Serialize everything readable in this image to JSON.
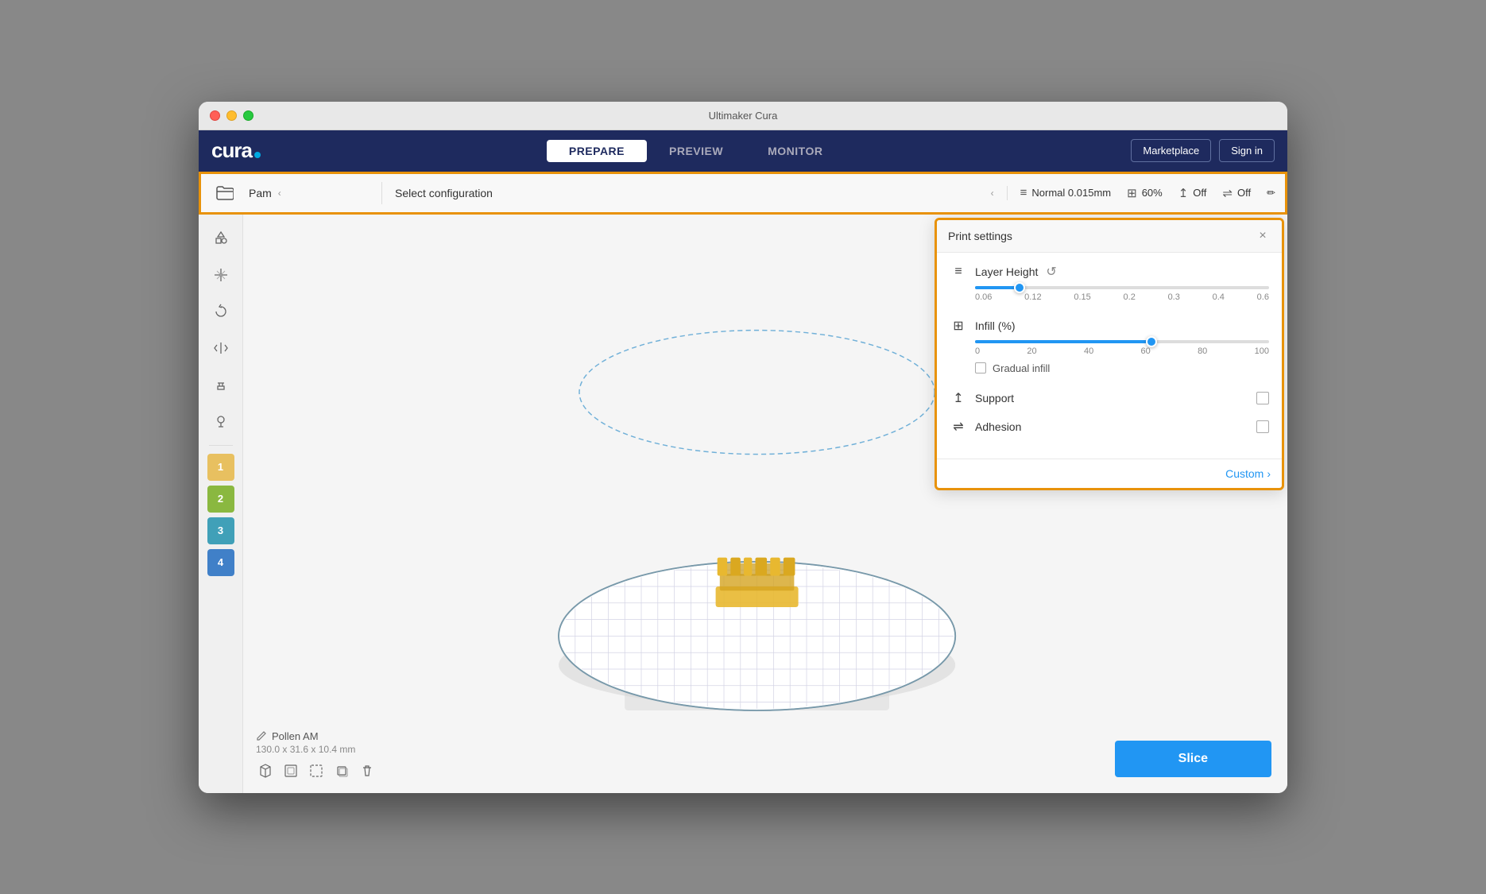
{
  "window": {
    "title": "Ultimaker Cura"
  },
  "nav": {
    "logo": "cura",
    "tabs": [
      {
        "label": "PREPARE",
        "active": true
      },
      {
        "label": "PREVIEW",
        "active": false
      },
      {
        "label": "MONITOR",
        "active": false
      }
    ],
    "marketplace_label": "Marketplace",
    "sign_in_label": "Sign in"
  },
  "toolbar": {
    "printer_name": "Pam",
    "config_name": "Select configuration",
    "profile": "Normal 0.015mm",
    "infill_pct": "60%",
    "support": "Off",
    "adhesion": "Off"
  },
  "sidebar": {
    "icons": [
      "⊞",
      "⊟",
      "⊠",
      "⊡",
      "◈",
      "◎"
    ],
    "materials": [
      {
        "number": "1",
        "color": "#e8c060"
      },
      {
        "number": "2",
        "color": "#a8c880"
      },
      {
        "number": "3",
        "color": "#60b8c8"
      },
      {
        "number": "4",
        "color": "#5898d8"
      }
    ]
  },
  "print_settings": {
    "title": "Print settings",
    "close_label": "×",
    "layer_height": {
      "label": "Layer Height",
      "marks": [
        "0.06",
        "0.12",
        "0.15",
        "0.2",
        "0.3",
        "0.4",
        "0.6"
      ]
    },
    "infill": {
      "label": "Infill (%)",
      "marks": [
        "0",
        "20",
        "40",
        "60",
        "80",
        "100"
      ],
      "value": 60,
      "fill_pct": 60
    },
    "gradual_infill_label": "Gradual infill",
    "support_label": "Support",
    "adhesion_label": "Adhesion",
    "custom_label": "Custom",
    "custom_chevron": "›"
  },
  "model": {
    "name": "Pollen AM",
    "size": "130.0 x 31.6 x 10.4 mm"
  },
  "slice_button": "Slice"
}
